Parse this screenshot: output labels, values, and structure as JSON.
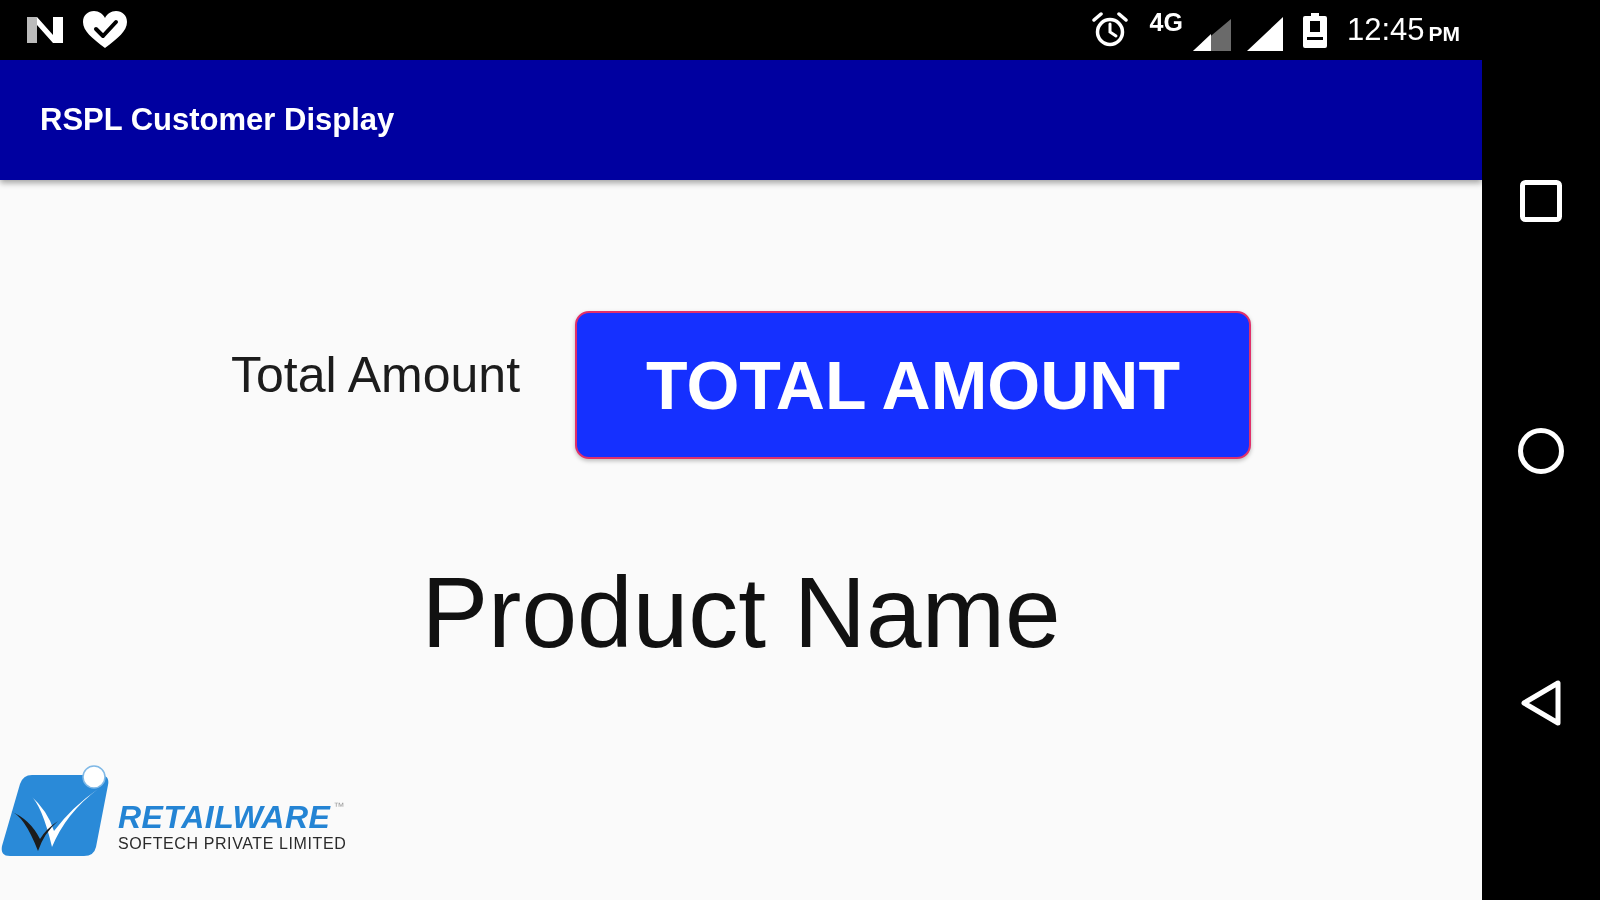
{
  "status_bar": {
    "network": "4G",
    "time": "12:45",
    "period": "PM"
  },
  "app_bar": {
    "title": "RSPL Customer Display"
  },
  "amount": {
    "label": "Total Amount",
    "button": "TOTAL AMOUNT"
  },
  "product": {
    "name": "Product Name"
  },
  "logo": {
    "name": "RETAILWARE",
    "trademark": "™",
    "tagline": "SOFTECH PRIVATE LIMITED"
  },
  "nav_bar": {
    "buttons": [
      {
        "kind": "recents"
      },
      {
        "kind": "home"
      },
      {
        "kind": "back"
      }
    ]
  }
}
